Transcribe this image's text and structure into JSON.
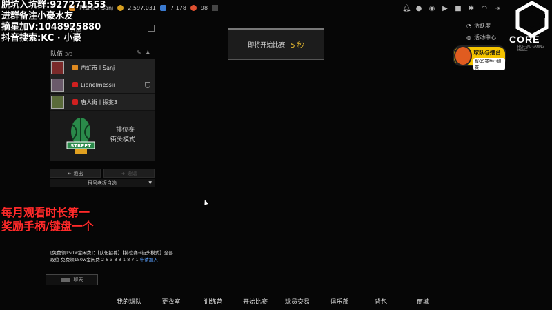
{
  "overlay": {
    "lines": [
      "脱坑入坑群:927271553",
      "进群备注小豪水友",
      "摘星加V:1048925880",
      "抖音搜索:KC · 小豪"
    ],
    "promo": [
      "每月观看时长第一",
      "奖励手柄/键盘一个"
    ]
  },
  "topbar": {
    "player": "西虹市丨Sanj",
    "coins": "2,597,031",
    "gems": "7,178",
    "tickets": "98",
    "plus": "+"
  },
  "top_icons": [
    "bell-icon",
    "user-icon",
    "friends-icon",
    "video-icon",
    "gift-icon",
    "gear-icon",
    "headset-icon",
    "exit-icon"
  ],
  "side_links": {
    "activity": "活跃度",
    "event_center": "活动中心"
  },
  "brand": {
    "name": "CORE",
    "tagline": "HIGH-END GAMING MOUSE",
    "sponsor_title": "球队@擂台",
    "sponsor_sub": "报Q5赛季小组赛"
  },
  "team": {
    "hint": "队伍",
    "collapse": "−",
    "label": "队伍",
    "count": "3/3",
    "members": [
      {
        "name": "西虹市丨Sanj",
        "rank_color": "#e08a20"
      },
      {
        "name": "Lionelmessii",
        "rank_color": "#d02020"
      },
      {
        "name": "唐人街丨探案3",
        "rank_color": "#d02020"
      }
    ],
    "mode_name": "排位赛",
    "mode_sub": "街头模式",
    "mode_logo_text": "STREET",
    "leave": "退出",
    "invite": "邀请",
    "select": "租号老板自选"
  },
  "toast": {
    "text": "即将开始比赛",
    "countdown": "5 秒"
  },
  "chat": {
    "message_part1": "[免费领150w金闲费]：【队伍招募】【排位赛→街头模式】全部段位  免费领150w金闲费 2 6 3 8 8 1 8 7 1",
    "link": "申请加入",
    "button": "聊天"
  },
  "bottom_nav": [
    "我的球队",
    "更衣室",
    "训练营",
    "开始比赛",
    "球员交易",
    "俱乐部",
    "背包",
    "商城"
  ],
  "colors": {
    "accent": "#f0c030",
    "link": "#5aa0ff",
    "promo": "#ff2a2a"
  }
}
